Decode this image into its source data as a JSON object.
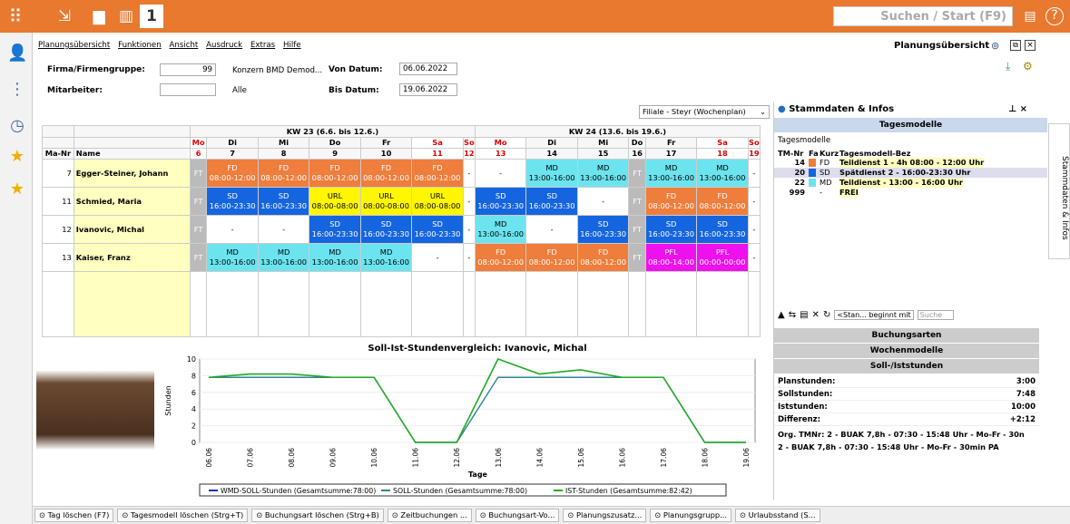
{
  "app": {
    "search_placeholder": "Suchen / Start (F9)",
    "title": "Planungsübersicht"
  },
  "menu": [
    "Planungsübersicht",
    "Funktionen",
    "Ansicht",
    "Ausdruck",
    "Extras",
    "Hilfe"
  ],
  "form": {
    "firma_label": "Firma/Firmengruppe:",
    "firma_value": "99",
    "firma_name": "Konzern BMD Demod...",
    "mitarbeiter_label": "Mitarbeiter:",
    "mitarbeiter_name": "Alle",
    "von_label": "Von Datum:",
    "von_value": "06.06.2022",
    "bis_label": "Bis Datum:",
    "bis_value": "19.06.2022"
  },
  "filiale": "Filiale - Steyr (Wochenplan)",
  "grid": {
    "week1": "KW 23 (6.6. bis 12.6.)",
    "week2": "KW 24 (13.6. bis 19.6.)",
    "col_nr": "Ma-Nr",
    "col_name": "Name",
    "days": [
      "Mo",
      "Di",
      "Mi",
      "Do",
      "Fr",
      "Sa",
      "So",
      "Mo",
      "Di",
      "Mi",
      "Do",
      "Fr",
      "Sa",
      "So"
    ],
    "dates": [
      "6",
      "7",
      "8",
      "9",
      "10",
      "11",
      "12",
      "13",
      "14",
      "15",
      "16",
      "17",
      "18",
      "19"
    ],
    "rows": [
      {
        "nr": "7",
        "name": "Egger-Steiner, Johann",
        "cells": [
          [
            "FT",
            ""
          ],
          [
            "FD",
            "08:00-12:00"
          ],
          [
            "FD",
            "08:00-12:00"
          ],
          [
            "FD",
            "08:00-12:00"
          ],
          [
            "FD",
            "08:00-12:00"
          ],
          [
            "FD",
            "08:00-12:00"
          ],
          [
            "-",
            ""
          ],
          [
            "-",
            ""
          ],
          [
            "MD",
            "13:00-16:00"
          ],
          [
            "MD",
            "13:00-16:00"
          ],
          [
            "FT",
            ""
          ],
          [
            "MD",
            "13:00-16:00"
          ],
          [
            "MD",
            "13:00-16:00"
          ],
          [
            "-",
            ""
          ]
        ]
      },
      {
        "nr": "11",
        "name": "Schmied, Maria",
        "cells": [
          [
            "FT",
            ""
          ],
          [
            "SD",
            "16:00-23:30"
          ],
          [
            "SD",
            "16:00-23:30"
          ],
          [
            "URL",
            "08:00-08:00"
          ],
          [
            "URL",
            "08:00-08:00"
          ],
          [
            "URL",
            "08:00-08:00"
          ],
          [
            "-",
            ""
          ],
          [
            "SD",
            "16:00-23:30"
          ],
          [
            "SD",
            "16:00-23:30"
          ],
          [
            "-",
            ""
          ],
          [
            "FT",
            ""
          ],
          [
            "FD",
            "08:00-12:00"
          ],
          [
            "FD",
            "08:00-12:00"
          ],
          [
            "-",
            ""
          ]
        ]
      },
      {
        "nr": "12",
        "name": "Ivanovic, Michal",
        "cells": [
          [
            "FT",
            ""
          ],
          [
            "-",
            ""
          ],
          [
            "-",
            ""
          ],
          [
            "SD",
            "16:00-23:30"
          ],
          [
            "SD",
            "16:00-23:30"
          ],
          [
            "SD",
            "16:00-23:30"
          ],
          [
            "-",
            ""
          ],
          [
            "MD",
            "13:00-16:00"
          ],
          [
            "-",
            ""
          ],
          [
            "SD",
            "16:00-23:30"
          ],
          [
            "FT",
            ""
          ],
          [
            "SD",
            "16:00-23:30"
          ],
          [
            "SD",
            "16:00-23:30"
          ],
          [
            "-",
            ""
          ]
        ]
      },
      {
        "nr": "13",
        "name": "Kaiser, Franz",
        "cells": [
          [
            "FT",
            ""
          ],
          [
            "MD",
            "13:00-16:00"
          ],
          [
            "MD",
            "13:00-16:00"
          ],
          [
            "MD",
            "13:00-16:00"
          ],
          [
            "MD",
            "13:00-16:00"
          ],
          [
            "-",
            ""
          ],
          [
            "-",
            ""
          ],
          [
            "FD",
            "08:00-12:00"
          ],
          [
            "FD",
            "08:00-12:00"
          ],
          [
            "FD",
            "08:00-12:00"
          ],
          [
            "FT",
            ""
          ],
          [
            "PFL",
            "08:00-14:00"
          ],
          [
            "PFL",
            "00:00-00:00"
          ],
          [
            "-",
            ""
          ]
        ]
      }
    ]
  },
  "chart_data": {
    "type": "line",
    "title": "Soll-Ist-Stundenvergleich: Ivanovic, Michal",
    "xlabel": "Tage",
    "ylabel": "Stunden",
    "ylim": [
      0,
      10
    ],
    "x": [
      "06.06",
      "07.06",
      "08.06",
      "09.06",
      "10.06",
      "11.06",
      "12.06",
      "13.06",
      "14.06",
      "15.06",
      "16.06",
      "17.06",
      "18.06",
      "19.06"
    ],
    "series": [
      {
        "name": "WMD-SOLL-Stunden (Gesamtsumme:78:00)",
        "color": "#1f2ec8",
        "values": [
          7.8,
          7.8,
          7.8,
          7.8,
          7.8,
          0,
          0,
          7.8,
          7.8,
          7.8,
          7.8,
          7.8,
          0,
          0
        ]
      },
      {
        "name": "SOLL-Stunden (Gesamtsumme:78:00)",
        "color": "#2a8a8a",
        "values": [
          7.8,
          7.8,
          7.8,
          7.8,
          7.8,
          0,
          0,
          7.8,
          7.8,
          7.8,
          7.8,
          7.8,
          0,
          0
        ]
      },
      {
        "name": "IST-Stunden (Gesamtsumme:82:42)",
        "color": "#22aa22",
        "values": [
          7.8,
          8.2,
          8.2,
          7.8,
          7.8,
          0,
          0,
          10,
          8.2,
          8.7,
          7.8,
          7.8,
          0,
          0
        ]
      }
    ]
  },
  "right": {
    "header": "Stammdaten & Infos",
    "tab": "Tagesmodelle",
    "sub": "Tagesmodelle",
    "cols": [
      "TM-Nr",
      "Fa",
      "Kurz",
      "Tagesmodell-Bez"
    ],
    "models": [
      {
        "nr": "14",
        "color": "#ef7d3b",
        "kurz": "FD",
        "bez": "Teildienst 1 - 4h 08:00 - 12:00 Uhr"
      },
      {
        "nr": "20",
        "color": "#1565e0",
        "kurz": "SD",
        "bez": "Spätdienst 2 - 16:00-23:30 Uhr"
      },
      {
        "nr": "22",
        "color": "#6be4ef",
        "kurz": "MD",
        "bez": "Teildienst - 13:00 - 16:00 Uhr"
      },
      {
        "nr": "999",
        "color": "#ffffff",
        "kurz": "-",
        "bez": "FREI"
      }
    ],
    "search_mode": "<Stan... beginnt mit",
    "search_placeholder": "Suche",
    "sections": [
      "Buchungsarten",
      "Wochenmodelle",
      "Soll-/Iststunden"
    ],
    "stats": [
      {
        "label": "Planstunden:",
        "value": "3:00"
      },
      {
        "label": "Sollstunden:",
        "value": "7:48"
      },
      {
        "label": "Iststunden:",
        "value": "10:00"
      },
      {
        "label": "Differenz:",
        "value": "+2:12"
      }
    ],
    "org": "Org. TMNr: 2 - BUAK 7,8h - 07:30 - 15:48 Uhr - Mo-Fr - 30n",
    "org2": "2 - BUAK 7,8h - 07:30 - 15:48 Uhr - Mo-Fr - 30min PA",
    "vtab": "Stammdaten & Infos"
  },
  "bottom": [
    "Tag löschen (F7)",
    "Tagesmodell löschen (Strg+T)",
    "Buchungsart löschen (Strg+B)",
    "Zeitbuchungen ...",
    "Buchungsart-Vo...",
    "Planungszusatz...",
    "Planungsgrupp...",
    "Urlaubsstand (S..."
  ]
}
